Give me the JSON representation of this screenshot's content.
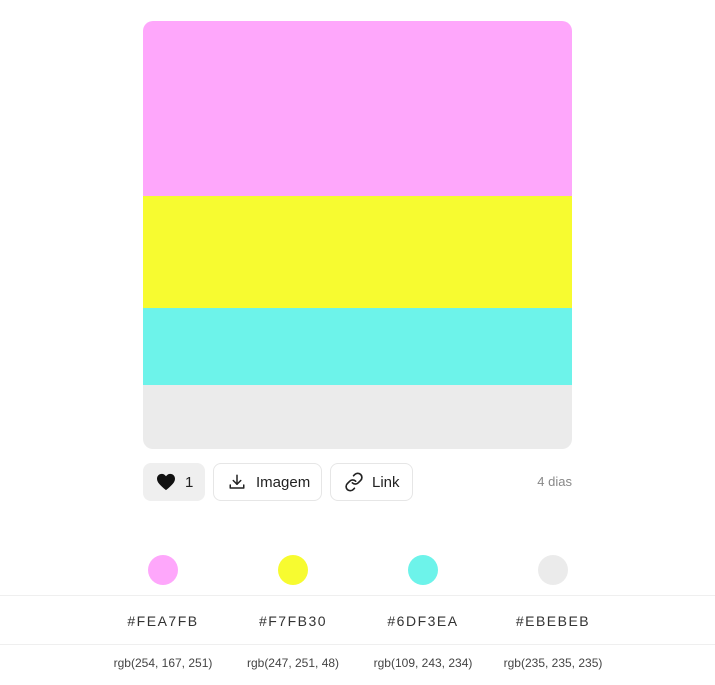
{
  "palette": {
    "colors": [
      {
        "hex": "#FEA7FB",
        "rgb": "rgb(254, 167, 251)",
        "band_fraction": 0.41
      },
      {
        "hex": "#F7FB30",
        "rgb": "rgb(247, 251, 48)",
        "band_fraction": 0.26
      },
      {
        "hex": "#6DF3EA",
        "rgb": "rgb(109, 243, 234)",
        "band_fraction": 0.18
      },
      {
        "hex": "#EBEBEB",
        "rgb": "rgb(235, 235, 235)",
        "band_fraction": 0.15
      }
    ]
  },
  "actions": {
    "like_count": "1",
    "image_label": "Imagem",
    "link_label": "Link",
    "date": "4 dias"
  },
  "icons": {
    "like": "heart-icon",
    "image": "download-icon",
    "link": "link-icon"
  }
}
